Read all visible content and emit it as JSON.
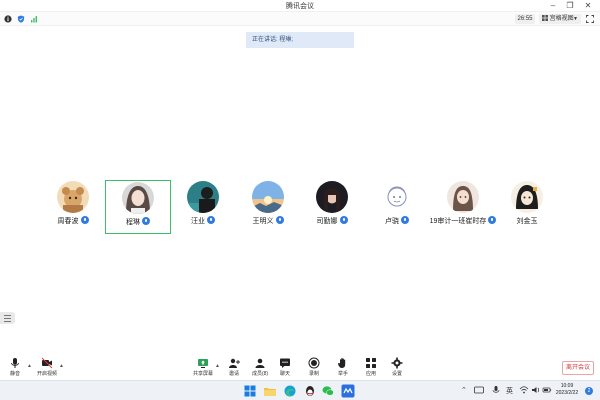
{
  "window": {
    "title": "腾讯会议"
  },
  "infobar": {
    "timer": "26:55",
    "view_label": "宫格视图"
  },
  "banner": {
    "speaking": "正在讲话: 程琳;"
  },
  "participants": [
    {
      "name": "周春波",
      "mic": true
    },
    {
      "name": "程琳",
      "mic": true,
      "active": true
    },
    {
      "name": "汪业",
      "mic": true
    },
    {
      "name": "王明义",
      "mic": true
    },
    {
      "name": "司勤娜",
      "mic": true
    },
    {
      "name": "卢骁",
      "mic": true
    },
    {
      "name": "19审计一班崔时存",
      "mic": true
    },
    {
      "name": "刘金玉",
      "mic": false
    }
  ],
  "toolbar": {
    "mute": "静音",
    "video": "开启视频",
    "share": "共享屏幕",
    "invite": "邀请",
    "members": "成员(8)",
    "chat": "聊天",
    "record": "录制",
    "raise_hand": "举手",
    "apps": "应用",
    "settings": "设置",
    "leave": "离开会议"
  },
  "taskbar": {
    "ime": "英",
    "time": "10:09",
    "date": "2023/2/22",
    "notifications": "2"
  },
  "colors": {
    "accent": "#2f7bdf",
    "active_border": "#3cbf69",
    "leave": "#d23b3b",
    "banner_bg": "#dfe9f7"
  }
}
